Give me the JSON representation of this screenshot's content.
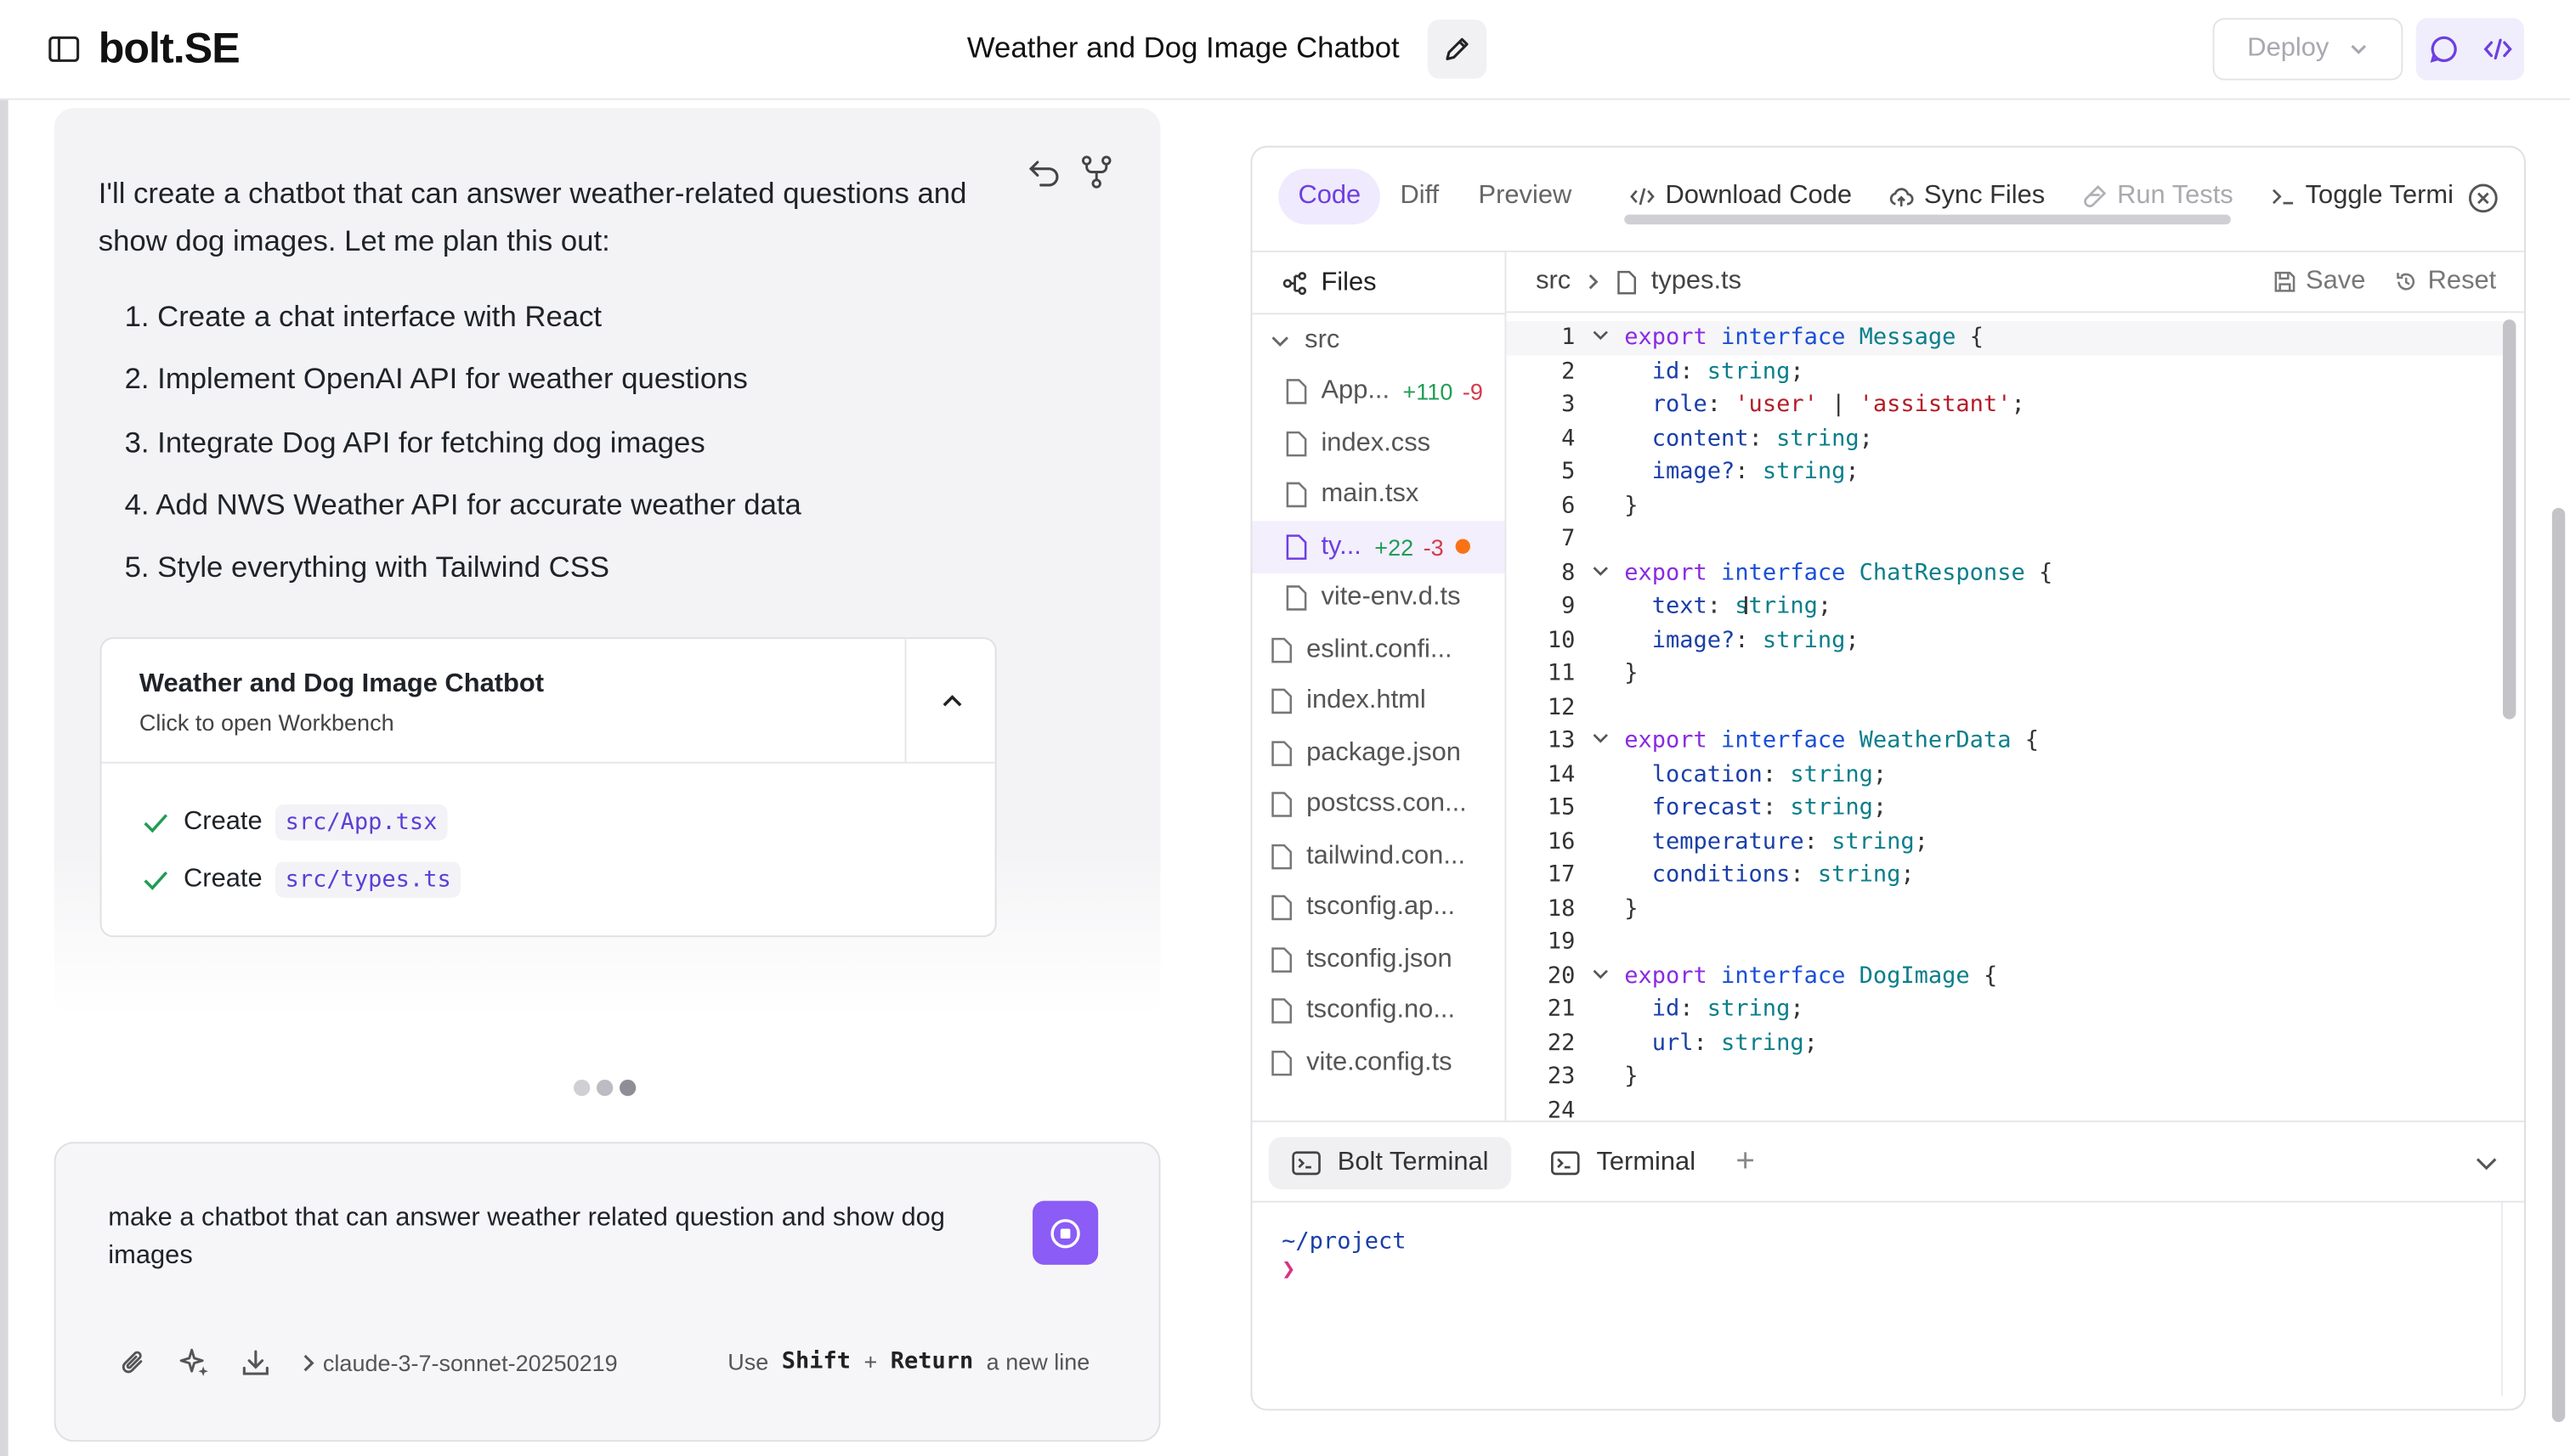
{
  "header": {
    "logo": "bolt.SE",
    "chat_title": "Weather and Dog Image Chatbot",
    "deploy_label": "Deploy"
  },
  "chat": {
    "intro": "I'll create a chatbot that can answer weather-related questions and show dog images. Let me plan this out:",
    "plan": [
      "1. Create a chat interface with React",
      "2. Implement OpenAI API for weather questions",
      "3. Integrate Dog API for fetching dog images",
      "4. Add NWS Weather API for accurate weather data",
      "5. Style everything with Tailwind CSS"
    ],
    "artifact": {
      "title": "Weather and Dog Image Chatbot",
      "subtitle": "Click to open Workbench",
      "actions": [
        {
          "verb": "Create",
          "path": "src/App.tsx"
        },
        {
          "verb": "Create",
          "path": "src/types.ts"
        }
      ]
    }
  },
  "prompt": {
    "text": "make a chatbot that can answer weather related question and show dog images",
    "model": "claude-3-7-sonnet-20250219",
    "hint_use": "Use",
    "hint_key1": "Shift",
    "hint_plus": "+",
    "hint_key2": "Return",
    "hint_tail": "a new line"
  },
  "workbench": {
    "tabs": [
      "Code",
      "Diff",
      "Preview"
    ],
    "active_tab": "Code",
    "actions": [
      "Download Code",
      "Sync Files",
      "Run Tests",
      "Toggle Termi"
    ],
    "files_label": "Files",
    "tree": [
      {
        "name": "src",
        "kind": "folder"
      },
      {
        "name": "App...",
        "kind": "file",
        "added": "+110",
        "removed": "-9"
      },
      {
        "name": "index.css",
        "kind": "file"
      },
      {
        "name": "main.tsx",
        "kind": "file"
      },
      {
        "name": "ty...",
        "kind": "file",
        "added": "+22",
        "removed": "-3",
        "selected": true
      },
      {
        "name": "vite-env.d.ts",
        "kind": "file"
      },
      {
        "name": "eslint.confi...",
        "kind": "file"
      },
      {
        "name": "index.html",
        "kind": "file"
      },
      {
        "name": "package.json",
        "kind": "file"
      },
      {
        "name": "postcss.con...",
        "kind": "file"
      },
      {
        "name": "tailwind.con...",
        "kind": "file"
      },
      {
        "name": "tsconfig.ap...",
        "kind": "file"
      },
      {
        "name": "tsconfig.json",
        "kind": "file"
      },
      {
        "name": "tsconfig.no...",
        "kind": "file"
      },
      {
        "name": "vite.config.ts",
        "kind": "file"
      }
    ],
    "breadcrumb": [
      "src",
      "types.ts"
    ],
    "save_label": "Save",
    "reset_label": "Reset",
    "code_lines": [
      "export interface Message {",
      "  id: string;",
      "  role: 'user' | 'assistant';",
      "  content: string;",
      "  image?: string;",
      "}",
      "",
      "export interface ChatResponse {",
      "  text: string;",
      "  image?: string;",
      "}",
      "",
      "export interface WeatherData {",
      "  location: string;",
      "  forecast: string;",
      "  temperature: string;",
      "  conditions: string;",
      "}",
      "",
      "export interface DogImage {",
      "  id: string;",
      "  url: string;",
      "}",
      ""
    ],
    "terminal_tabs": [
      "Bolt Terminal",
      "Terminal"
    ],
    "terminal_path": "~/project",
    "terminal_prompt": "❯"
  },
  "colors": {
    "accent": "#8b5cf6",
    "accent_text": "#6d3fe0",
    "diff_add": "#1f9d55",
    "diff_del": "#d73a49",
    "modified_dot": "#f97316"
  }
}
